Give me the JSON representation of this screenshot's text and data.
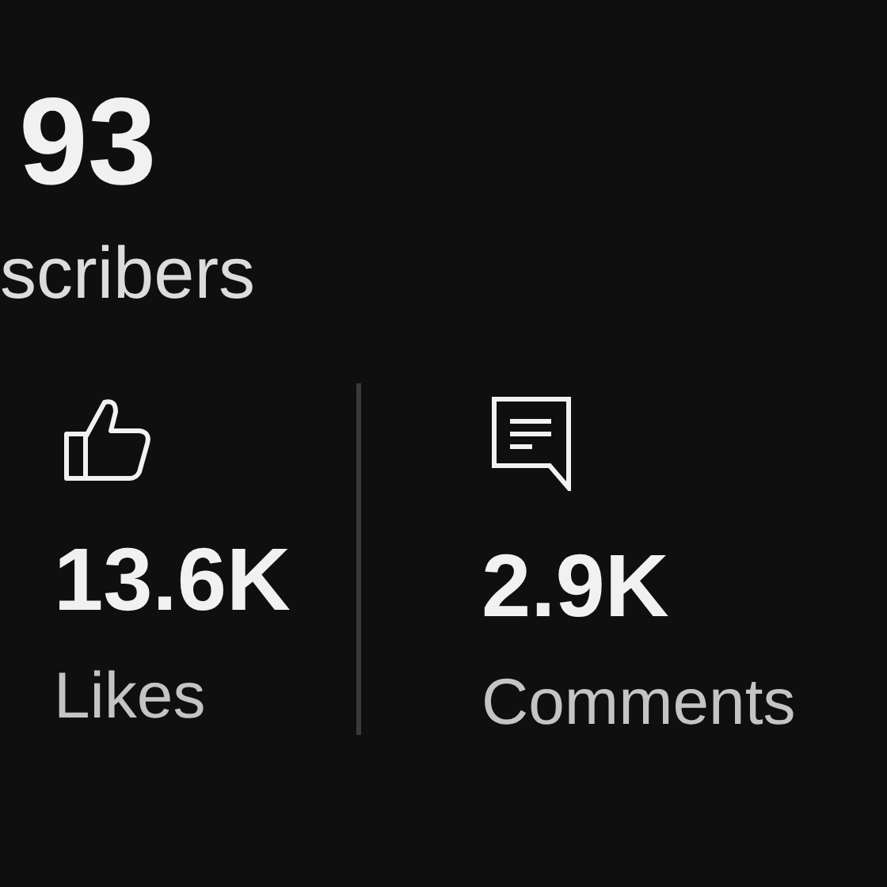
{
  "subscribers": {
    "count": "93",
    "label": "scribers"
  },
  "stats": [
    {
      "kind": "likes",
      "value": "13.6K",
      "label": "Likes"
    },
    {
      "kind": "comments",
      "value": "2.9K",
      "label": "Comments"
    }
  ]
}
